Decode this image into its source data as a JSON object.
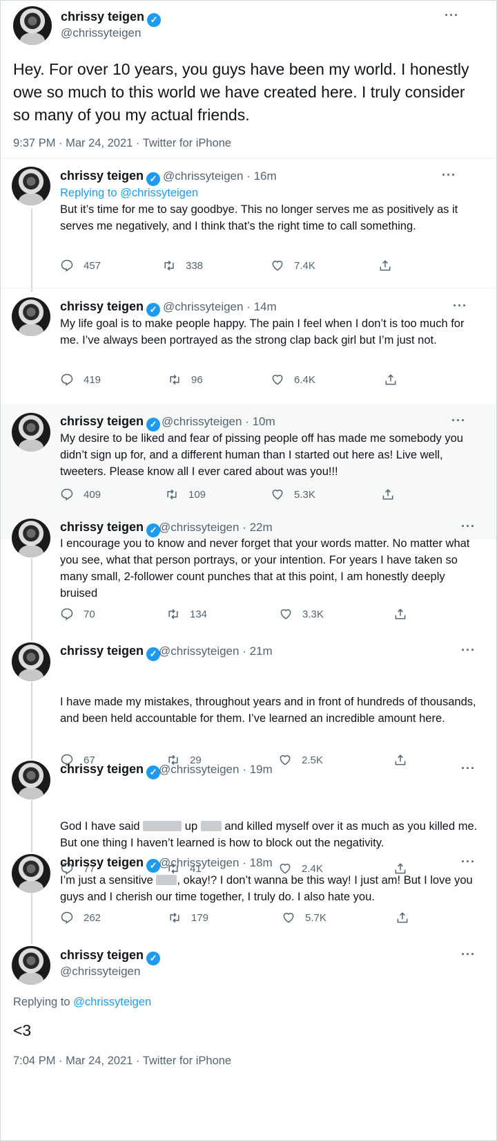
{
  "author": {
    "name": "chrissy teigen",
    "handle": "@chrissyteigen",
    "verified_icon": "verified-badge-icon",
    "menu_icon": "more-options-icon"
  },
  "main_tweet": {
    "text": "Hey. For over 10 years, you guys have been my world. I honestly owe so much to this world we have created here. I truly consider so many of you my actual friends.",
    "timestamp": "9:37 PM · Mar 24, 2021 · Twitter for iPhone"
  },
  "thread": [
    {
      "time": "· 16m",
      "replying_prefix": "Replying to",
      "replying_handle": "@chrissyteigen",
      "text": "But it’s time for me to say goodbye. This no longer serves me as positively as it serves me negatively, and I think that’s the right time to call something.",
      "replies": "457",
      "retweets": "338",
      "likes": "7.4K"
    },
    {
      "time": "· 14m",
      "text": "My life goal is to make people happy. The pain I feel when I don’t is too much for me. I’ve always been portrayed as the strong clap back girl but I’m just not.",
      "replies": "419",
      "retweets": "96",
      "likes": "6.4K"
    },
    {
      "time": "· 10m",
      "text": "My desire to be liked and fear of pissing people off has made me somebody you didn’t sign up for, and a different human than I started out here as! Live well, tweeters. Please know all I ever cared about was you!!!",
      "replies": "409",
      "retweets": "109",
      "likes": "5.3K"
    },
    {
      "time": "· 22m",
      "text": "I encourage you to know and never forget that your words matter. No matter what you see, what that person portrays, or your intention. For years I have taken so many small, 2-follower count punches that at this point, I am honestly deeply bruised",
      "replies": "70",
      "retweets": "134",
      "likes": "3.3K"
    },
    {
      "time": "· 21m",
      "text": "I have made my mistakes, throughout years and in front of hundreds of thousands, and been held accountable for them. I’ve learned an incredible amount here.",
      "replies": "67",
      "retweets": "29",
      "likes": "2.5K"
    },
    {
      "time": "· 19m",
      "text_a": "God I have said",
      "text_b": "up",
      "text_c": "and killed myself over it as much as you killed me. But one thing I haven’t learned is how to block out the negativity.",
      "replies": "77",
      "retweets": "41",
      "likes": "2.4K"
    },
    {
      "time": "· 18m",
      "text_a": "I’m just a sensitive",
      "text_b": ", okay!? I don’t wanna be this way! I just am! But I love you guys and I cherish our time together, I truly do. I also hate you.",
      "replies": "262",
      "retweets": "179",
      "likes": "5.7K"
    }
  ],
  "final_tweet": {
    "replying_prefix": "Replying to",
    "replying_handle": "@chrissyteigen",
    "text": "<3",
    "timestamp": "7:04 PM · Mar 24, 2021 · Twitter for iPhone"
  },
  "icons": {
    "reply": "reply-icon",
    "retweet": "retweet-icon",
    "like": "like-icon",
    "share": "share-icon"
  },
  "colors": {
    "accent": "#1d9bf0",
    "secondary_text": "#536471",
    "highlight_bg": "#f7f9f9"
  }
}
